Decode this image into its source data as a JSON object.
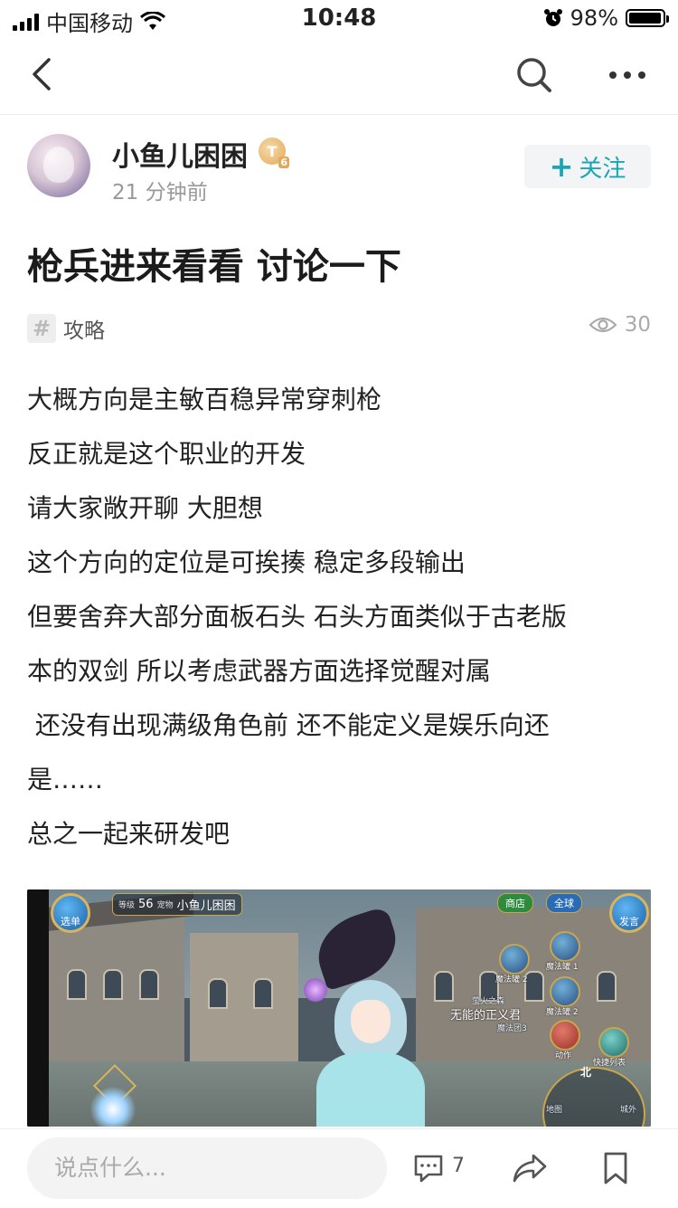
{
  "status_bar": {
    "carrier": "中国移动",
    "time": "10:48",
    "battery_percent": "98%",
    "battery_level": 0.98
  },
  "nav": {
    "back_icon": "chevron-left-icon",
    "search_icon": "search-icon",
    "more_icon": "more-horizontal-icon"
  },
  "author": {
    "name": "小鱼儿困困",
    "level_badge": "T",
    "level_badge_sub": "6",
    "post_time": "21 分钟前",
    "follow_plus": "+",
    "follow_label": "关注"
  },
  "post": {
    "title": "枪兵进来看看 讨论一下",
    "tag_symbol": "#",
    "tag": "攻略",
    "views": "30",
    "body_lines": [
      "大概方向是主敏百稳异常穿刺枪",
      "反正就是这个职业的开发",
      "请大家敞开聊 大胆想",
      "这个方向的定位是可挨揍 稳定多段输出",
      "但要舍弃大部分面板石头 石头方面类似于古老版",
      "本的双剑 所以考虑武器方面选择觉醒对属",
      " 还没有出现满级角色前 还不能定义是娱乐向还",
      "是……",
      "总之一起来研发吧"
    ]
  },
  "game_screenshot": {
    "player_level_label": "等级",
    "player_level": "56",
    "player_level_suffix": "宠物",
    "player_name": "小鱼儿困困",
    "top_left_button": "选单",
    "shop_button": "商店",
    "world_button": "全球",
    "top_right_button": "发言",
    "skill_1": "魔法罐 2",
    "skill_2": "魔法罐 1",
    "skill_3": "魔法罐 2",
    "skill_4": "动作",
    "skill_5": "快捷列表",
    "npc_sub": "萤火之森",
    "npc_title": "无能的正义君",
    "npc_sub2": "魔法团3",
    "compass_north": "北",
    "map_left": "地图",
    "map_right": "城外"
  },
  "bottom_bar": {
    "comment_placeholder": "说点什么...",
    "comment_count": "7",
    "comment_icon": "comment-icon",
    "share_icon": "share-icon",
    "bookmark_icon": "bookmark-icon"
  }
}
